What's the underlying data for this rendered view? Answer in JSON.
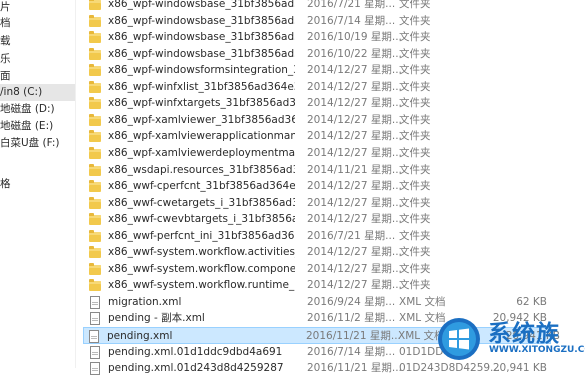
{
  "nav": {
    "items": [
      {
        "label": "片"
      },
      {
        "label": "档"
      },
      {
        "label": "载"
      },
      {
        "label": "乐"
      },
      {
        "label": "面"
      },
      {
        "label": "/in8 (C:)",
        "selected": true
      },
      {
        "label": "地磁盘 (D:)"
      },
      {
        "label": "地磁盘 (E:)"
      },
      {
        "label": "白菜U盘 (F:)"
      },
      {
        "label": ""
      },
      {
        "label": "格"
      }
    ]
  },
  "files": [
    {
      "icon": "folder-icon",
      "name": "x86_wpf-windowsbase_31bf3856ad36...",
      "date": "2016/7/21 星期...",
      "type": "文件夹",
      "size": ""
    },
    {
      "icon": "folder-icon",
      "name": "x86_wpf-windowsbase_31bf3856ad36...",
      "date": "2016/7/14 星期...",
      "type": "文件夹",
      "size": ""
    },
    {
      "icon": "folder-icon",
      "name": "x86_wpf-windowsbase_31bf3856ad36...",
      "date": "2016/10/19 星期...",
      "type": "文件夹",
      "size": ""
    },
    {
      "icon": "folder-icon",
      "name": "x86_wpf-windowsbase_31bf3856ad36...",
      "date": "2016/10/22 星期...",
      "type": "文件夹",
      "size": ""
    },
    {
      "icon": "folder-icon",
      "name": "x86_wpf-windowsformsintegration_31...",
      "date": "2014/12/27 星期...",
      "type": "文件夹",
      "size": ""
    },
    {
      "icon": "folder-icon",
      "name": "x86_wpf-winfxlist_31bf3856ad364e35_...",
      "date": "2014/12/27 星期...",
      "type": "文件夹",
      "size": ""
    },
    {
      "icon": "folder-icon",
      "name": "x86_wpf-winfxtargets_31bf3856ad364...",
      "date": "2014/12/27 星期...",
      "type": "文件夹",
      "size": ""
    },
    {
      "icon": "folder-icon",
      "name": "x86_wpf-xamlviewer_31bf3856ad364e...",
      "date": "2014/12/27 星期...",
      "type": "文件夹",
      "size": ""
    },
    {
      "icon": "folder-icon",
      "name": "x86_wpf-xamlviewerapplicationmanif...",
      "date": "2014/12/27 星期...",
      "type": "文件夹",
      "size": ""
    },
    {
      "icon": "folder-icon",
      "name": "x86_wpf-xamlviewerdeploymentmanif...",
      "date": "2014/12/27 星期...",
      "type": "文件夹",
      "size": ""
    },
    {
      "icon": "folder-icon",
      "name": "x86_wsdapi.resources_31bf3856ad36...",
      "date": "2014/11/21 星期...",
      "type": "文件夹",
      "size": ""
    },
    {
      "icon": "folder-icon",
      "name": "x86_wwf-cperfcnt_31bf3856ad364e35_...",
      "date": "2014/12/27 星期...",
      "type": "文件夹",
      "size": ""
    },
    {
      "icon": "folder-icon",
      "name": "x86_wwf-cwetargets_i_31bf3856ad36...",
      "date": "2014/12/27 星期...",
      "type": "文件夹",
      "size": ""
    },
    {
      "icon": "folder-icon",
      "name": "x86_wwf-cwevbtargets_i_31bf3856ad...",
      "date": "2014/12/27 星期...",
      "type": "文件夹",
      "size": ""
    },
    {
      "icon": "folder-icon",
      "name": "x86_wwf-perfcnt_ini_31bf3856ad364e...",
      "date": "2016/7/21 星期...",
      "type": "文件夹",
      "size": ""
    },
    {
      "icon": "folder-icon",
      "name": "x86_wwf-system.workflow.activities_3...",
      "date": "2014/12/27 星期...",
      "type": "文件夹",
      "size": ""
    },
    {
      "icon": "folder-icon",
      "name": "x86_wwf-system.workflow.component...",
      "date": "2014/12/27 星期...",
      "type": "文件夹",
      "size": ""
    },
    {
      "icon": "folder-icon",
      "name": "x86_wwf-system.workflow.runtime_31...",
      "date": "2014/12/27 星期...",
      "type": "文件夹",
      "size": ""
    },
    {
      "icon": "file-icon",
      "name": "migration.xml",
      "date": "2016/9/24 星期...",
      "type": "XML 文档",
      "size": "62 KB"
    },
    {
      "icon": "file-icon",
      "name": "pending - 副本.xml",
      "date": "2016/11/2 星期...",
      "type": "XML 文档",
      "size": "20,942 KB"
    },
    {
      "icon": "file-icon",
      "name": "pending.xml",
      "date": "2016/11/21 星期...",
      "type": "XML 文档",
      "size": "20,941 KB",
      "selected": true
    },
    {
      "icon": "file-icon",
      "name": "pending.xml.01d1ddc9dbd4a691",
      "date": "2016/7/14 星期...",
      "type": "01D1DDC9",
      "size": ""
    },
    {
      "icon": "file-icon",
      "name": "pending.xml.01d243d8d4259287",
      "date": "2016/11/21 星期...",
      "type": "01D243D8D4259...",
      "size": "20,941 KB"
    }
  ],
  "watermark": {
    "text": "系统族",
    "url": "WWW.XITONGZU.COM",
    "colors": {
      "primary": "#1b6fc2",
      "secondary": "#2f9be0"
    }
  }
}
